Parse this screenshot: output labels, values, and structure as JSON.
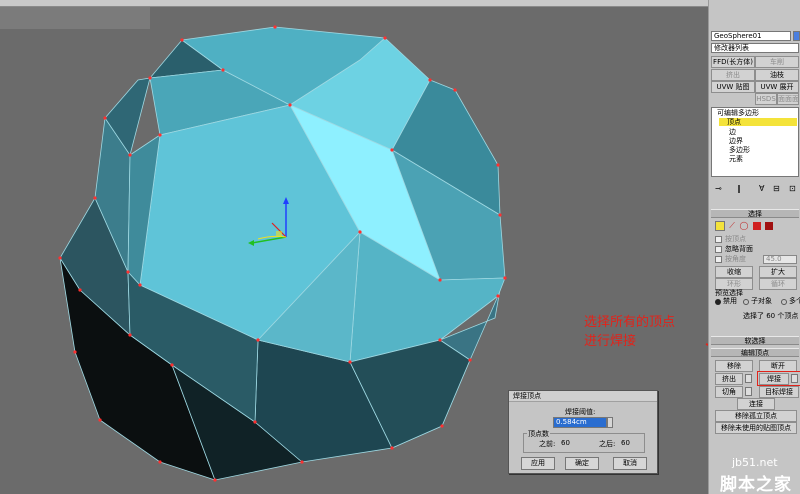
{
  "modifier_panel": {
    "object_name": "GeoSphere01",
    "modifier_list": "修改器列表",
    "buttons": {
      "ffd": "FFD(长方体)",
      "turbosmooth": "车削",
      "extrude": "挤出",
      "lathe": "油枝",
      "uvw_map": "UVW 贴图",
      "uvw_unwrap": "UVW 展开",
      "hsds": "HSDS",
      "smooth": "面面面"
    },
    "stack": {
      "root": "可编辑多边形",
      "items": [
        "顶点",
        "边",
        "边界",
        "多边形",
        "元素"
      ]
    },
    "selection": {
      "header": "选择",
      "by_vertex": "按顶点",
      "ignore_backfacing": "忽略背面",
      "by_angle": "按角度",
      "angle_value": "45.0",
      "shrink": "收缩",
      "grow": "扩大",
      "ring": "环形",
      "loop": "循环",
      "preview_label": "预览选择",
      "preview_off": "禁用",
      "preview_sub": "子对象",
      "preview_multi": "多个",
      "status": "选择了 60 个顶点"
    },
    "soft_selection": "软选择",
    "edit_vertices": {
      "header": "编辑顶点",
      "remove": "移除",
      "break": "断开",
      "extrude": "挤出",
      "weld": "焊接",
      "chamfer": "切角",
      "target_weld": "目标焊接",
      "connect": "连接",
      "remove_isolated": "移除孤立顶点",
      "remove_unused": "移除未使用的贴图顶点"
    }
  },
  "weld_dialog": {
    "title": "焊接顶点",
    "threshold_label": "焊接阈值:",
    "threshold_value": "0.584cm",
    "vertex_count_label": "顶点数",
    "before_label": "之前:",
    "before_value": "60",
    "after_label": "之后:",
    "after_value": "60",
    "apply": "应用",
    "ok": "确定",
    "cancel": "取消"
  },
  "annotation": "选择所有的顶点\n进行焊接",
  "watermark": {
    "url": "jb51.net",
    "text": "脚本之家"
  },
  "colors": {
    "accent_red": "#e2231a",
    "sphere_light": "#5fc4d8",
    "sphere_dark": "#2e6a78",
    "selected_item": "#f4e33a"
  }
}
